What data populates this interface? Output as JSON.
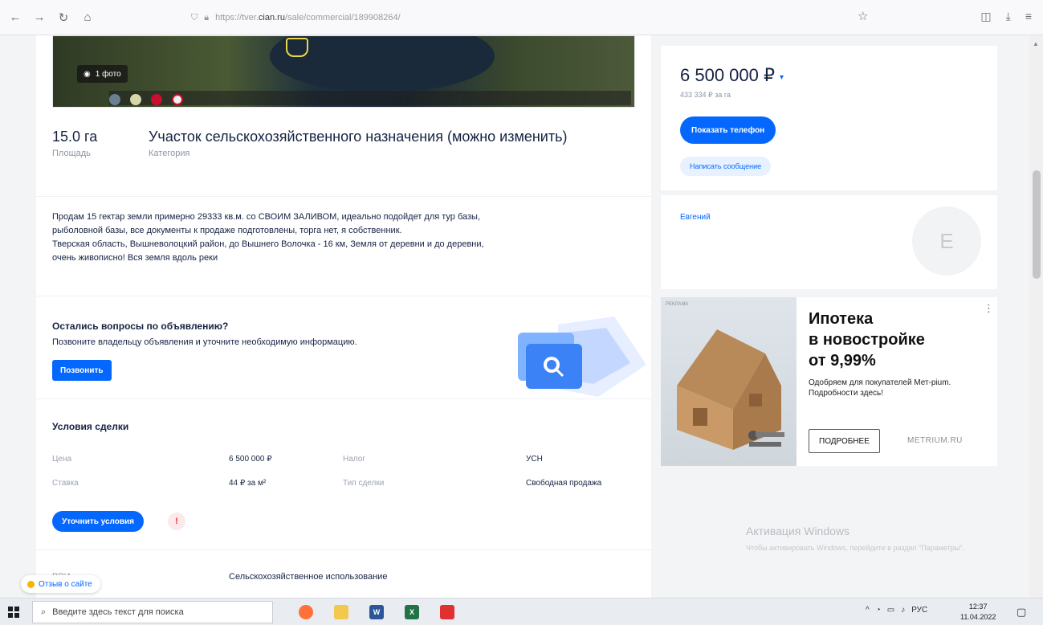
{
  "browser": {
    "url_prefix": "https://tver.",
    "url_host": "cian.ru",
    "url_path": "/sale/commercial/189908264/"
  },
  "listing": {
    "photo_count": "1 фото",
    "area_value": "15.0 га",
    "area_label": "Площадь",
    "category_value": "Участок сельскохозяйственного назначения (можно изменить)",
    "category_label": "Категория",
    "description": [
      "Продам 15 гектар земли примерно 29333 кв.м. со СВОИМ ЗАЛИВОМ, идеально подойдет для тур базы,",
      "рыболовной базы, все документы к продаже подготовлены, торга нет, я собственник.",
      "Тверская область, Вышневолоцкий район, до Вышнего Волочка - 16 км, Земля от деревни и до деревни,",
      "очень живописно! Вся земля вдоль реки"
    ]
  },
  "questions": {
    "title": "Остались вопросы по объявлению?",
    "text": "Позвоните владельцу объявления и уточните необходимую информацию.",
    "call_label": "Позвонить"
  },
  "deal": {
    "title": "Условия сделки",
    "rows": [
      {
        "label1": "Цена",
        "value1": "6 500 000 ₽",
        "label2": "Налог",
        "value2": "УСН"
      },
      {
        "label1": "Ставка",
        "value1": "44 ₽ за м²",
        "label2": "Тип сделки",
        "value2": "Свободная продажа"
      }
    ],
    "clarify_label": "Уточнить условия",
    "usage_label": "ВРИ",
    "usage_value": "Сельскохозяйственное использование"
  },
  "feedback_label": "Отзыв о сайте",
  "sidebar": {
    "price": "6 500 000 ₽",
    "price_per": "433 334 ₽ за га",
    "phone_button": "Показать телефон",
    "message_button": "Написать сообщение",
    "seller_name": "Евгений",
    "avatar_letter": "E"
  },
  "ad": {
    "label": "РЕКЛАМА",
    "title_line1": "Ипотека",
    "title_line2": "в новостройке",
    "title_line3": "от 9,99%",
    "text": "Одобряем для покупателей Мет-рium. Подробности здесь!",
    "more_button": "ПОДРОБНЕЕ",
    "brand": "METRIUM.RU"
  },
  "watermark": {
    "title": "Активация Windows",
    "text": "Чтобы активировать Windows, перейдите в раздел \"Параметры\"."
  },
  "taskbar": {
    "search_placeholder": "Введите здесь текст для поиска",
    "lang": "РУС",
    "time": "12:37",
    "date": "11.04.2022"
  },
  "colors": {
    "accent": "#0468ff",
    "text": "#152242",
    "muted": "#8b95a7",
    "warn": "#e4324b"
  },
  "icons": [
    "back-icon",
    "forward-icon",
    "reload-icon",
    "home-icon",
    "shield-icon",
    "lock-icon",
    "star-icon",
    "pocket-icon",
    "download-icon",
    "extensions-icon",
    "camera-icon",
    "magnifier-folder-icon",
    "warning-icon",
    "windows-start-icon",
    "search-icon"
  ]
}
